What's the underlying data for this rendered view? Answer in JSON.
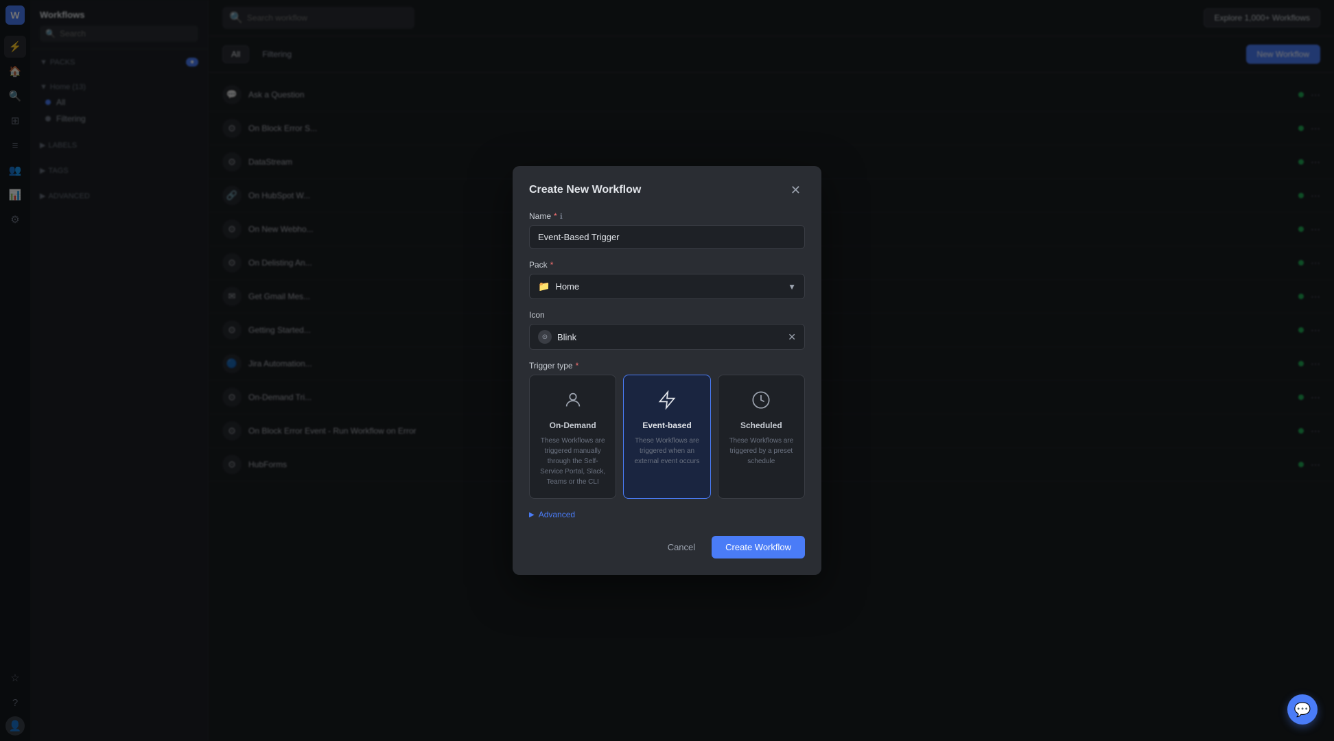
{
  "app": {
    "title": "Workflows"
  },
  "sidebar": {
    "search_placeholder": "Search",
    "sections": [
      {
        "label": "PACKS",
        "badge": "",
        "items": []
      },
      {
        "label": "Home (13)",
        "badge": "",
        "items": []
      },
      {
        "label": "LABELS",
        "items": []
      },
      {
        "label": "TAGS",
        "items": []
      },
      {
        "label": "ADVANCED",
        "items": []
      }
    ]
  },
  "toolbar": {
    "search_placeholder": "Search workflow",
    "explore_btn": "Explore 1,000+ Workflows",
    "new_workflow_btn": "New Workflow"
  },
  "filter": {
    "tabs": [
      "All",
      "Filtering"
    ]
  },
  "workflows": [
    {
      "name": "Ask a Question",
      "icon": "💬",
      "status": "green"
    },
    {
      "name": "On Block Error S...",
      "icon": "⊙",
      "status": "green"
    },
    {
      "name": "DataStream",
      "icon": "⊙",
      "status": "green"
    },
    {
      "name": "On HubSpot W...",
      "icon": "⊙",
      "status": "green"
    },
    {
      "name": "On New Webho...",
      "icon": "⊙",
      "status": "green"
    },
    {
      "name": "On Delisting An...",
      "icon": "⊙",
      "status": "green"
    },
    {
      "name": "Get Gmail Mes...",
      "icon": "✉",
      "status": "green"
    },
    {
      "name": "Getting Started...",
      "icon": "⊙",
      "status": "green"
    },
    {
      "name": "Jira Automation...",
      "icon": "⊙",
      "status": "green"
    },
    {
      "name": "On-Demand Tri...",
      "icon": "⊙",
      "status": "green"
    },
    {
      "name": "On Block Error Event - Run Workflow on Error",
      "icon": "⊙",
      "status": "green"
    },
    {
      "name": "HubForms",
      "icon": "⊙",
      "status": "green"
    }
  ],
  "modal": {
    "title": "Create New Workflow",
    "name_label": "Name",
    "name_required": "*",
    "name_value": "Event-Based Trigger",
    "pack_label": "Pack",
    "pack_required": "*",
    "pack_value": "Home",
    "icon_label": "Icon",
    "icon_value": "Blink",
    "trigger_label": "Trigger type",
    "trigger_required": "*",
    "trigger_types": [
      {
        "id": "on-demand",
        "title": "On-Demand",
        "description": "These Workflows are triggered manually through the Self-Service Portal, Slack, Teams or the CLI",
        "selected": false
      },
      {
        "id": "event-based",
        "title": "Event-based",
        "description": "These Workflows are triggered when an external event occurs",
        "selected": true
      },
      {
        "id": "scheduled",
        "title": "Scheduled",
        "description": "These Workflows are triggered by a preset schedule",
        "selected": false
      }
    ],
    "advanced_label": "Advanced",
    "cancel_label": "Cancel",
    "create_label": "Create Workflow"
  }
}
